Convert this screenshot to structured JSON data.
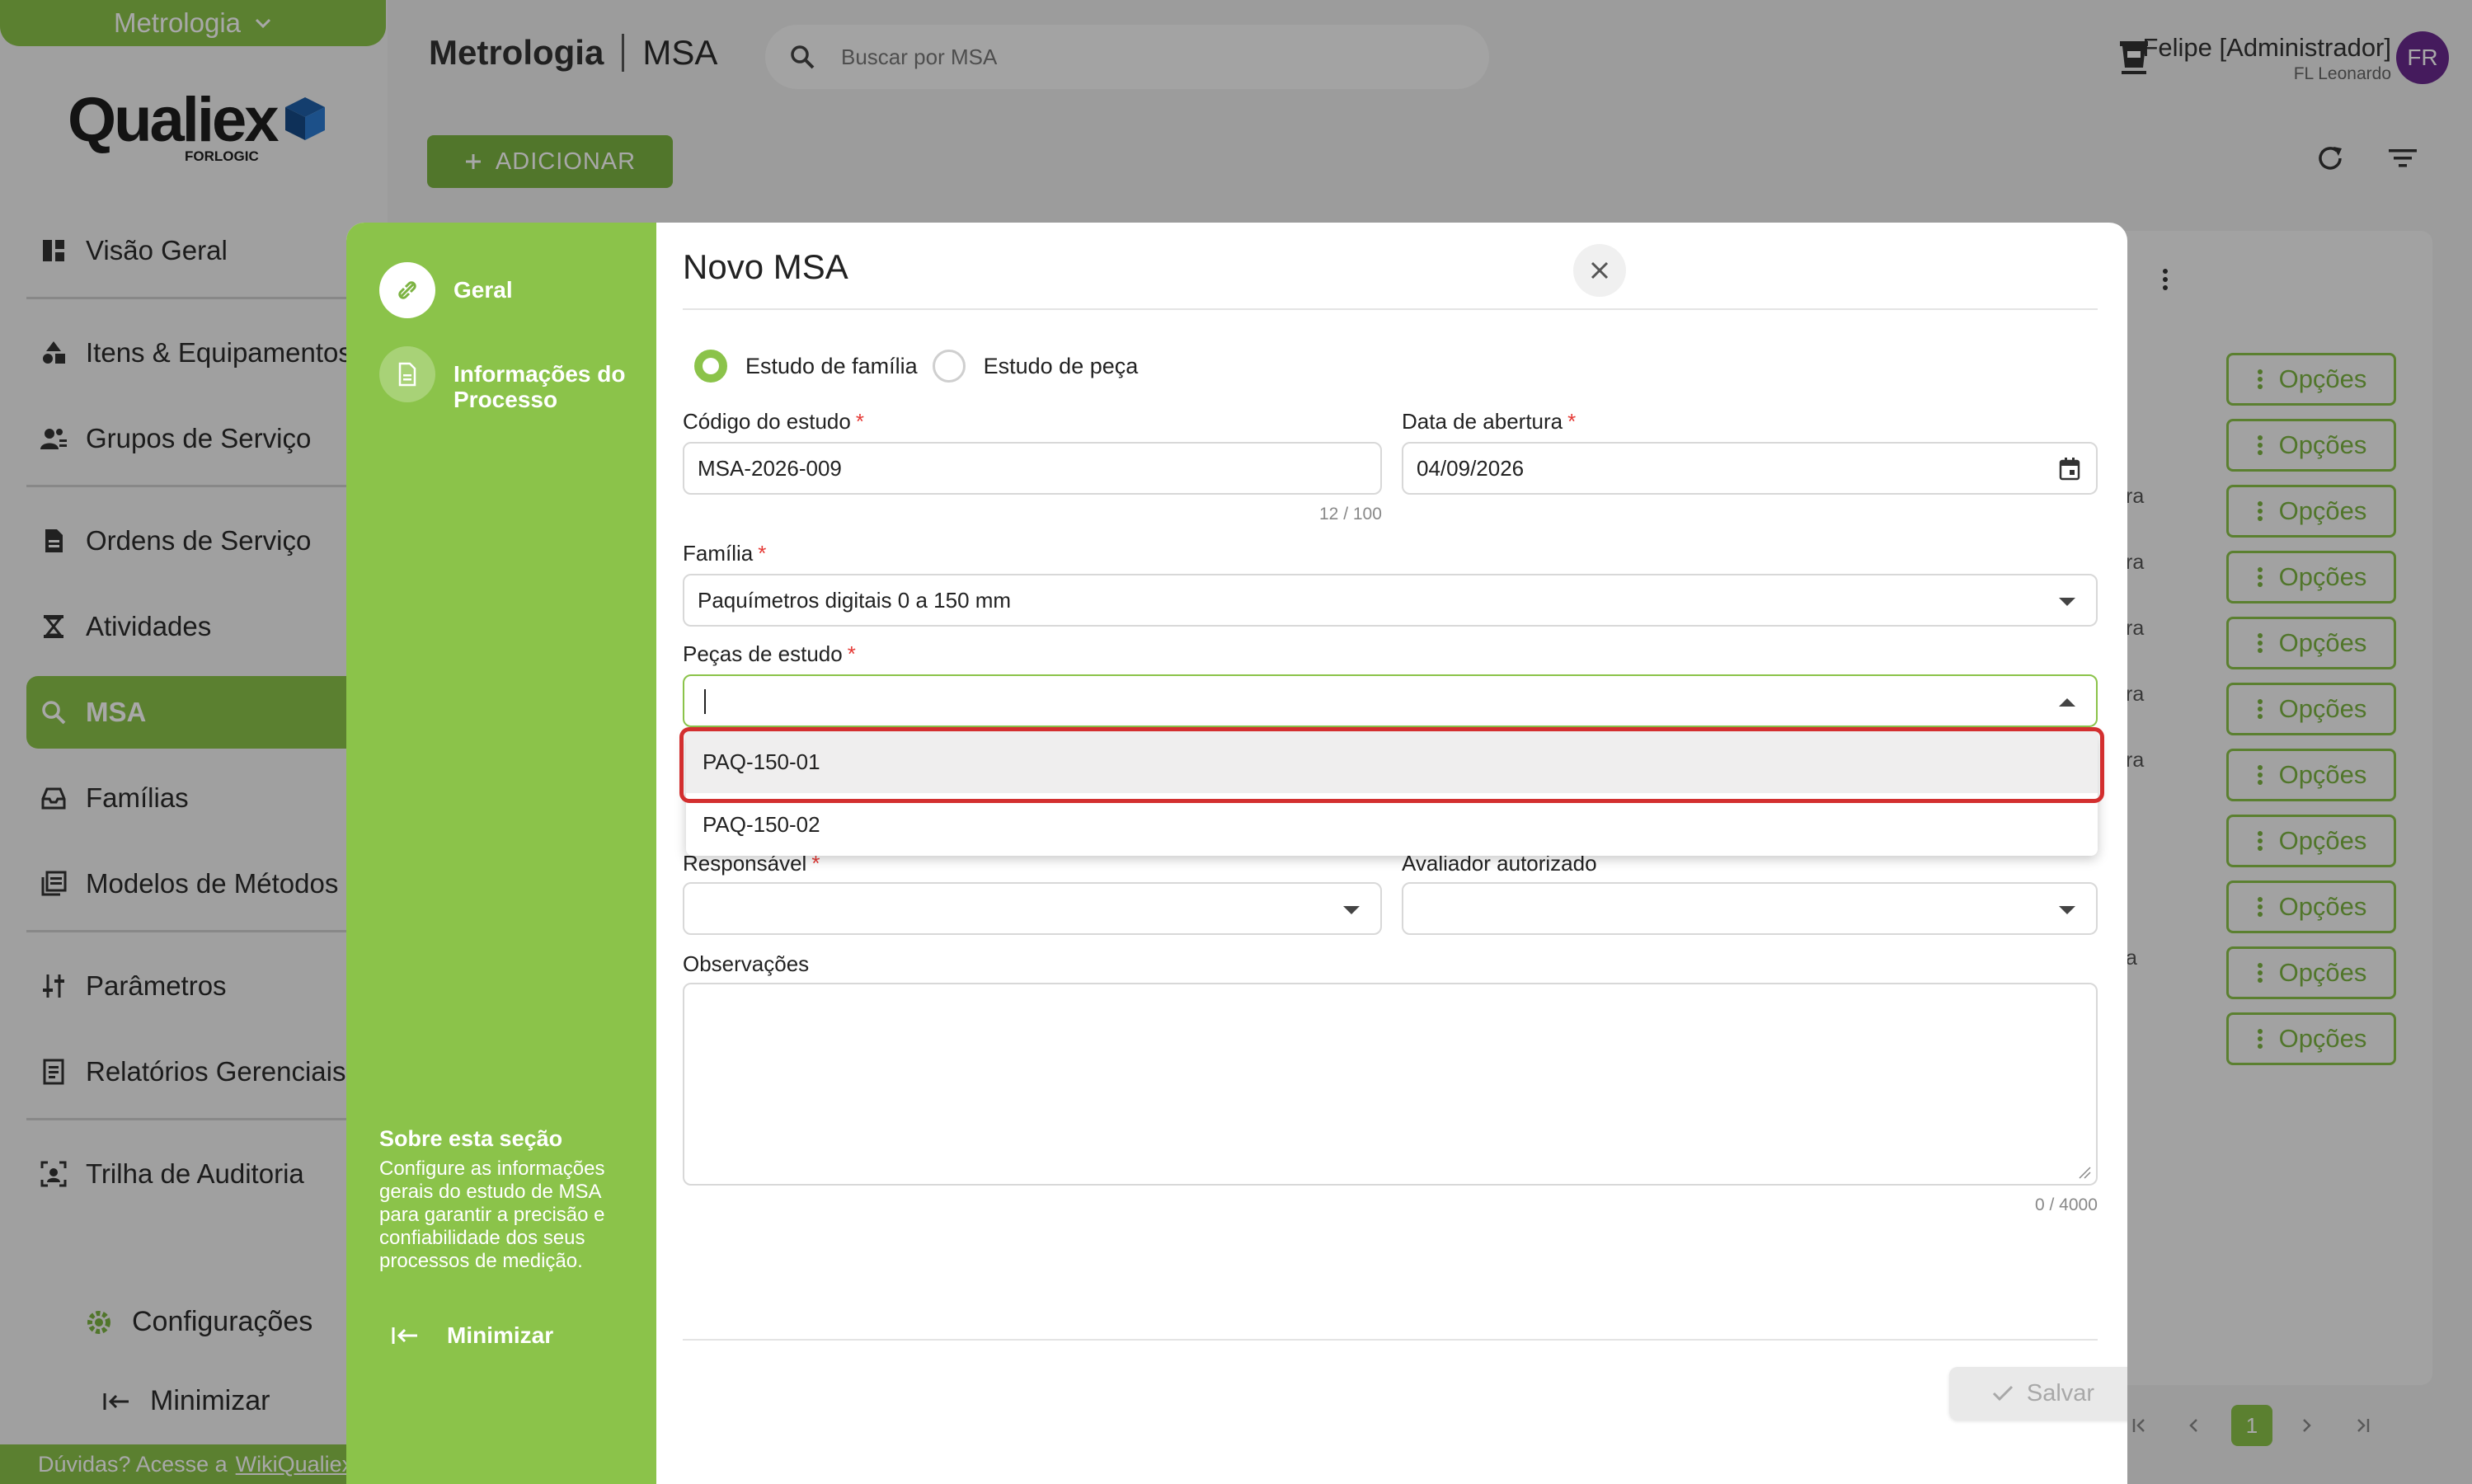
{
  "sidebar": {
    "module": "Metrologia",
    "logo": {
      "word": "Qualiex",
      "sub": "FORLOGIC"
    },
    "items": [
      {
        "label": "Visão Geral",
        "icon": "dashboard-icon"
      },
      {
        "label": "Itens & Equipamentos",
        "icon": "shapes-icon"
      },
      {
        "label": "Grupos de Serviço",
        "icon": "group-icon"
      },
      {
        "label": "Ordens de Serviço",
        "icon": "document-icon"
      },
      {
        "label": "Atividades",
        "icon": "hourglass-icon"
      },
      {
        "label": "MSA",
        "icon": "zoom-icon",
        "active": true
      },
      {
        "label": "Famílias",
        "icon": "inbox-icon"
      },
      {
        "label": "Modelos de Métodos",
        "icon": "library-icon"
      },
      {
        "label": "Parâmetros",
        "icon": "sliders-icon"
      },
      {
        "label": "Relatórios Gerenciais",
        "icon": "report-icon"
      },
      {
        "label": "Trilha de Auditoria",
        "icon": "audit-icon"
      }
    ],
    "settings": "Configurações",
    "minimize": "Minimizar",
    "help": {
      "text": "Dúvidas? Acesse a",
      "link": "WikiQualiex"
    }
  },
  "header": {
    "title": "Metrologia",
    "subtitle": "MSA",
    "search_placeholder": "Buscar por MSA",
    "user_name": "Felipe [Administrador]",
    "user_org": "FL Leonardo",
    "avatar": "FR"
  },
  "toolbar": {
    "add_label": "ADICIONAR"
  },
  "table": {
    "row_fragments": [
      "ra",
      "ra",
      "ra",
      "ra",
      "ra",
      "a"
    ],
    "options_label": "Opções",
    "option_count": 11,
    "current_page": "1"
  },
  "modal": {
    "title": "Novo MSA",
    "steps": [
      {
        "label": "Geral",
        "active": true
      },
      {
        "label": "Informações do Processo",
        "active": false
      }
    ],
    "about_title": "Sobre esta seção",
    "about_text": "Configure as informações gerais do estudo de MSA para garantir a precisão e confiabilidade dos seus processos de medição.",
    "minimize": "Minimizar",
    "study_types": [
      {
        "label": "Estudo de família",
        "selected": true
      },
      {
        "label": "Estudo de peça",
        "selected": false
      }
    ],
    "fields": {
      "codigo": {
        "label": "Código do estudo",
        "value": "MSA-2026-009",
        "counter": "12 / 100"
      },
      "data": {
        "label": "Data de abertura",
        "value": "04/09/2026"
      },
      "familia": {
        "label": "Família",
        "value": "Paquímetros digitais 0 a 150 mm"
      },
      "pecas": {
        "label": "Peças de estudo",
        "value": ""
      },
      "responsavel": {
        "label": "Responsável",
        "value": ""
      },
      "avaliador": {
        "label": "Avaliador autorizado",
        "value": ""
      },
      "observacoes": {
        "label": "Observações",
        "counter": "0 / 4000"
      }
    },
    "dropdown_options": [
      "PAQ-150-01",
      "PAQ-150-02"
    ],
    "save_label": "Salvar"
  },
  "colors": {
    "brand_green": "#8bc34a",
    "required": "#e53935",
    "highlight": "#d32f2f",
    "avatar": "#6a2a8e"
  }
}
